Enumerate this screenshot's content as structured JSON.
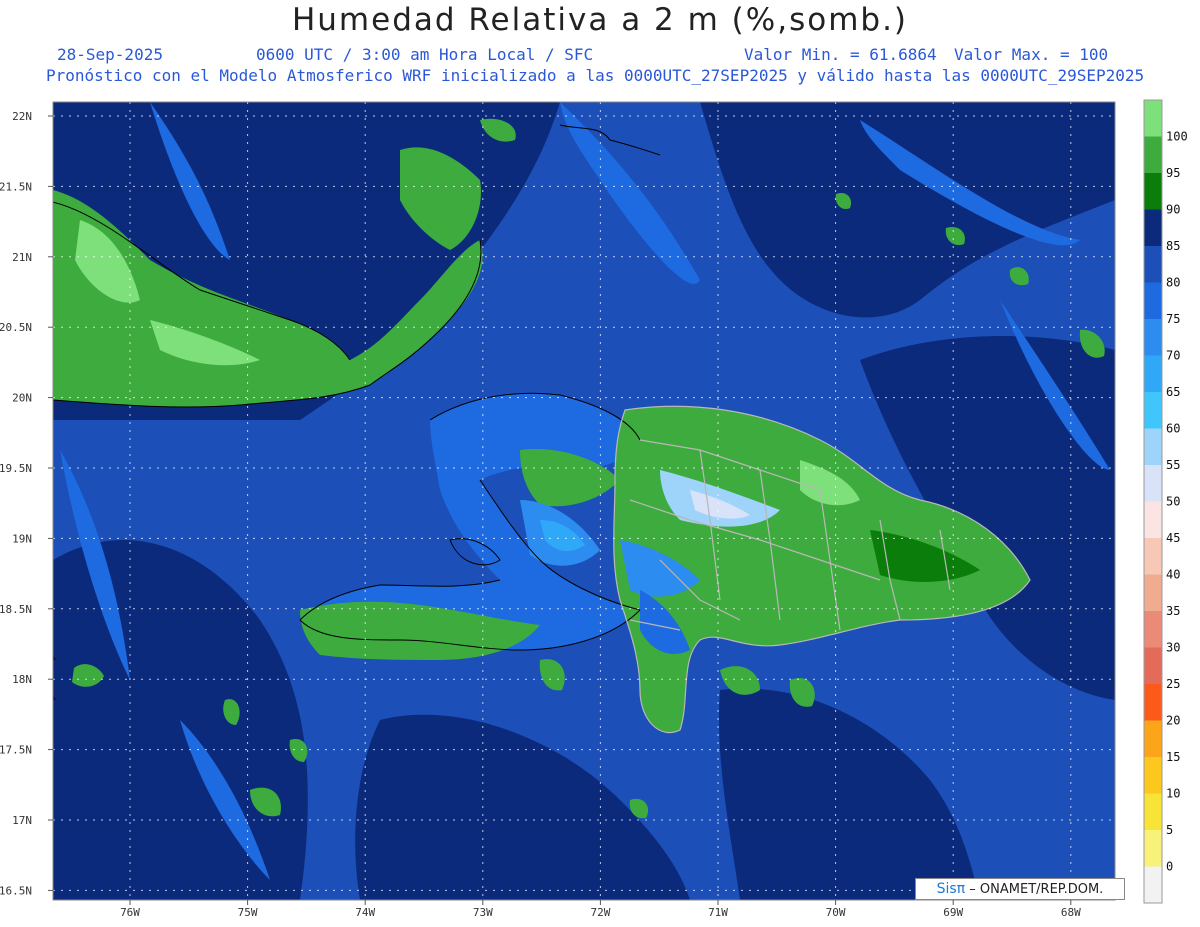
{
  "header": {
    "title": "Humedad Relativa a 2 m (%,somb.)",
    "date": "28-Sep-2025",
    "time_info": "0600 UTC / 3:00 am Hora Local / SFC",
    "value_min": "Valor Min. = 61.6864",
    "value_max": "Valor Max. = 100",
    "forecast_info": "Pronóstico con el Modelo Atmosferico WRF inicializado a las 0000UTC_27SEP2025 y válido hasta las 0000UTC_29SEP2025"
  },
  "axes": {
    "lat_labels": [
      "22N",
      "21.5N",
      "21N",
      "20.5N",
      "20N",
      "19.5N",
      "19N",
      "18.5N",
      "18N",
      "17.5N",
      "17N",
      "16.5N"
    ],
    "lon_labels": [
      "76W",
      "75W",
      "74W",
      "73W",
      "72W",
      "71W",
      "70W",
      "69W",
      "68W"
    ]
  },
  "colorbar": {
    "labels": [
      "100",
      "95",
      "90",
      "85",
      "80",
      "75",
      "70",
      "65",
      "60",
      "55",
      "50",
      "45",
      "40",
      "35",
      "30",
      "25",
      "20",
      "15",
      "10",
      "5",
      "0"
    ],
    "colors": [
      "#7ee07a",
      "#3eab3e",
      "#0a7d0a",
      "#0c2a7c",
      "#1c4fb8",
      "#1e6ae0",
      "#2c8cf0",
      "#30a8f8",
      "#40c6fa",
      "#9ed4fa",
      "#d8e2f8",
      "#fbe4e4",
      "#f8c8b6",
      "#f0ac8e",
      "#ec8a78",
      "#e46a5a",
      "#fc5a1a",
      "#fca41a",
      "#fcc81e",
      "#f8e436",
      "#f8f27a",
      "#f2f2f2"
    ]
  },
  "credit": {
    "logo": "Sisπ",
    "text": "– ONAMET/REP.DOM."
  },
  "colors": {
    "ocean_dark": "#0c2a7c",
    "ocean": "#1c4fb8",
    "ocean_light": "#1e6ae0",
    "land_green": "#3eab3e",
    "land_dark_green": "#0a7d0a",
    "land_light_green": "#7ee07a",
    "header_blue": "#2a58d8"
  },
  "icons": {
    "credit_logo": "sispi-logo"
  }
}
